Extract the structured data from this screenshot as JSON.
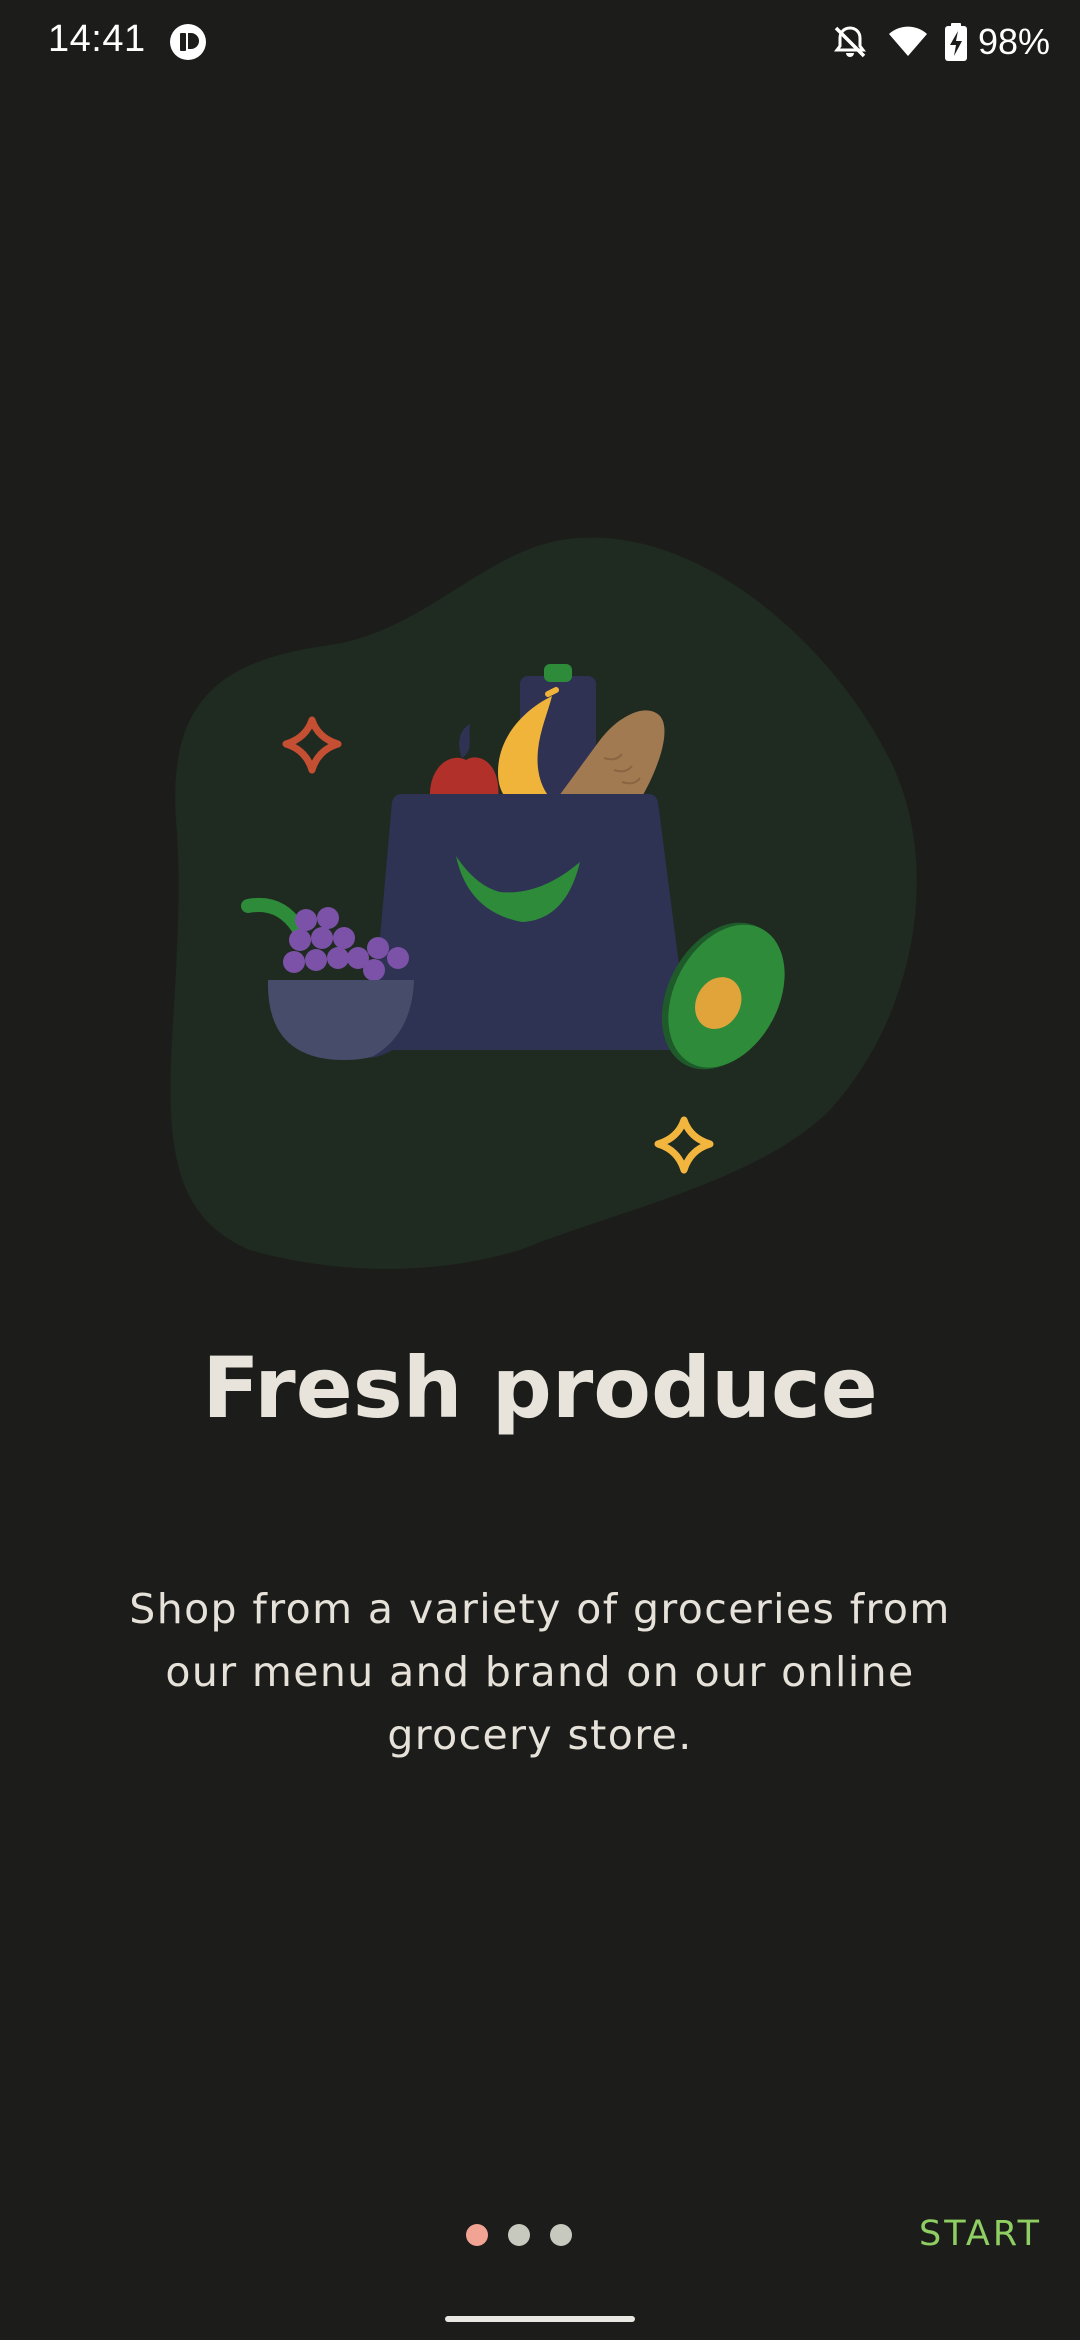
{
  "status_bar": {
    "time": "14:41",
    "battery_percent": "98%",
    "icons": [
      "app-notification-icon",
      "notifications-off-icon",
      "wifi-icon",
      "battery-charging-icon"
    ]
  },
  "onboarding": {
    "title": "Fresh produce",
    "description": "Shop from a variety of groceries from our menu and brand on our online grocery store.",
    "illustration": "grocery-bag-icon",
    "pager": {
      "total": 3,
      "current": 1
    },
    "start_label": "START"
  },
  "colors": {
    "background": "#1c1d1a",
    "accent": "#8fce62",
    "active_dot": "#f1a493",
    "inactive_dot": "#c7c9be"
  }
}
